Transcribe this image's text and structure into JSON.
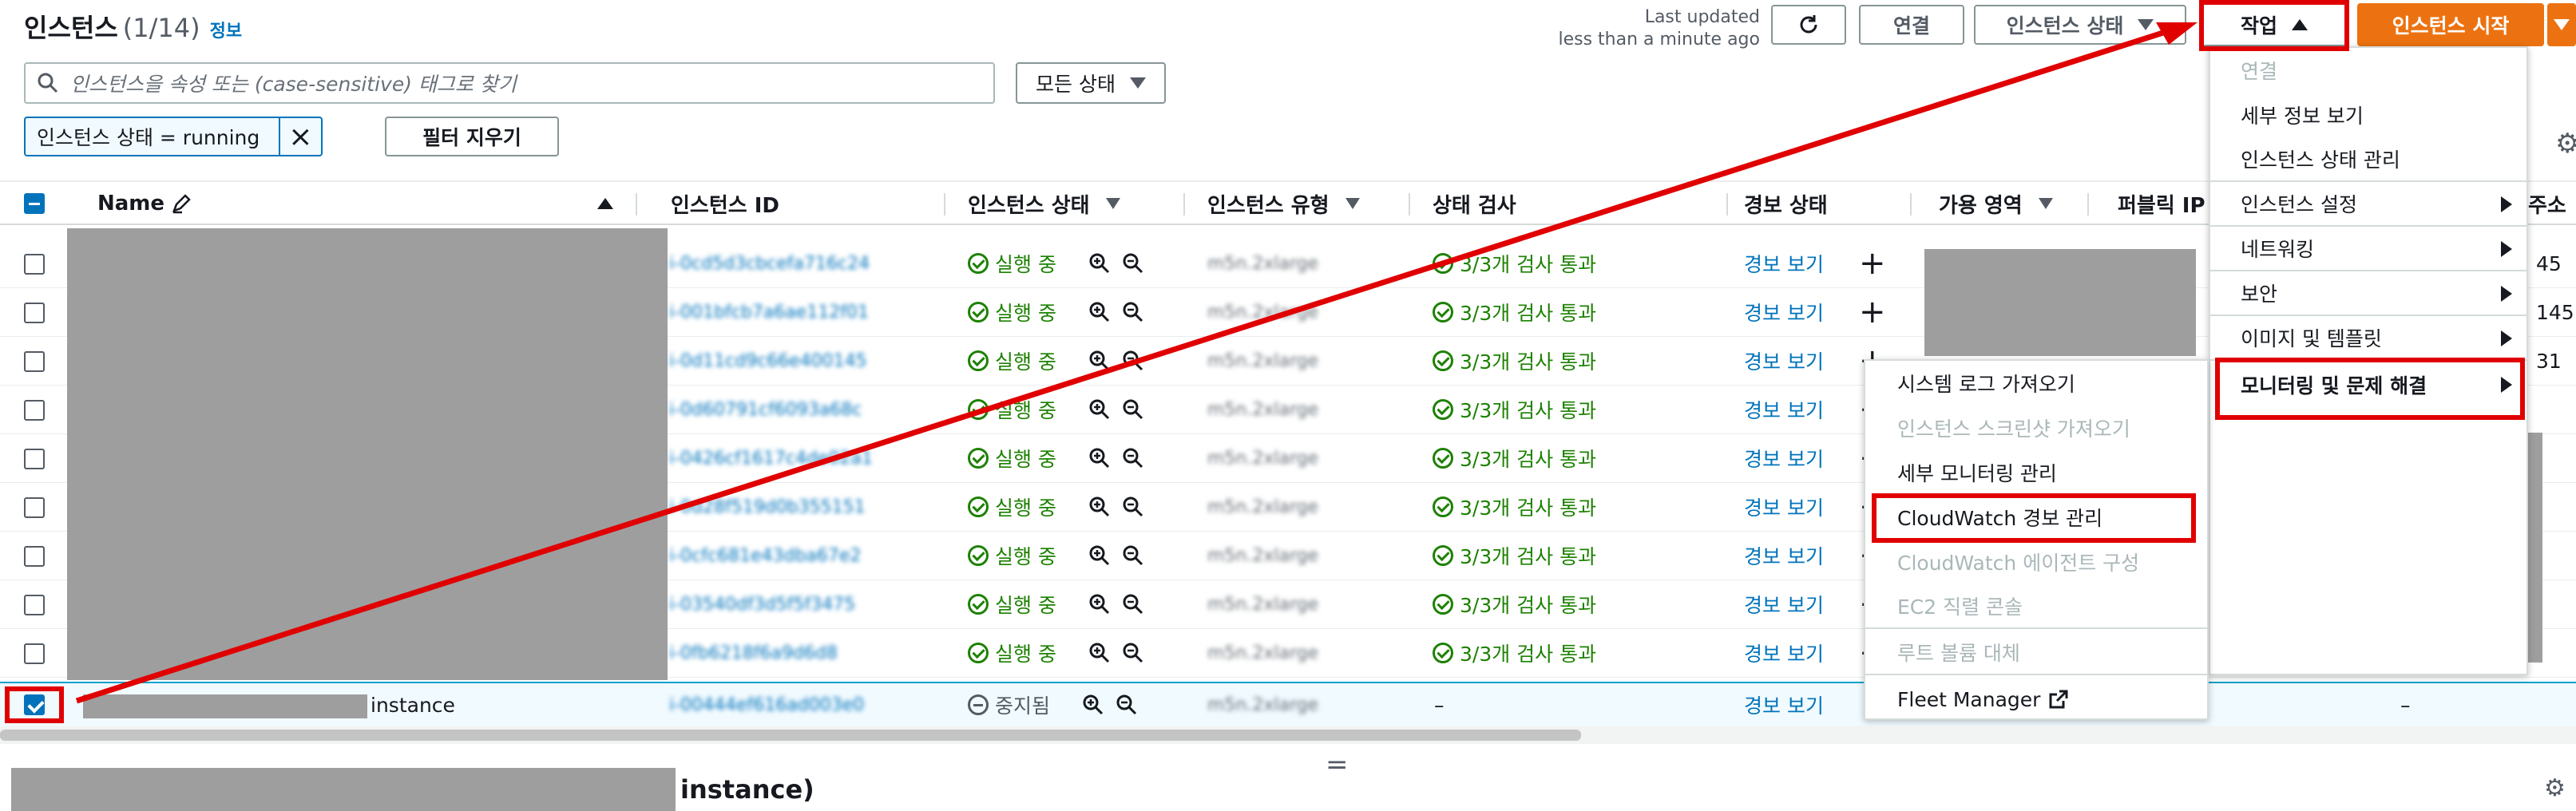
{
  "header": {
    "title": "인스턴스",
    "count": "(1/14)",
    "info": "정보",
    "last_updated_line1": "Last updated",
    "last_updated_line2": "less than a minute ago",
    "connect_label": "연결",
    "instance_state_label": "인스턴스 상태",
    "actions_label": "작업",
    "launch_label": "인스턴스 시작"
  },
  "search": {
    "placeholder": "인스턴스을 속성 또는 (case-sensitive) 태그로 찾기",
    "status_filter": "모든 상태"
  },
  "filter": {
    "chip": "인스턴스 상태 = running",
    "clear_label": "필터 지우기"
  },
  "table": {
    "columns": {
      "name": "Name",
      "instance_id": "인스턴스 ID",
      "state": "인스턴스 상태",
      "type": "인스턴스 유형",
      "status_check": "상태 검사",
      "alarm": "경보 상태",
      "az": "가용 영역",
      "public_ip": "퍼블릭 IP",
      "address": "주소"
    },
    "rows": [
      {
        "id": "i-0cd5d3cbcefa716c24",
        "state": "실행 중",
        "type": "m5n.2xlarge",
        "check": "3/3개 검사 통과",
        "alarm": "경보 보기",
        "ip_tail": "45"
      },
      {
        "id": "i-001bfcb7a6ae112f01",
        "state": "실행 중",
        "type": "m5n.2xlarge",
        "check": "3/3개 검사 통과",
        "alarm": "경보 보기",
        "ip_tail": "145"
      },
      {
        "id": "i-0d11cd9c66e400145",
        "state": "실행 중",
        "type": "m5n.2xlarge",
        "check": "3/3개 검사 통과",
        "alarm": "경보 보기",
        "ip_tail": "31"
      },
      {
        "id": "i-0d60791cf6093a68c",
        "state": "실행 중",
        "type": "m5n.2xlarge",
        "check": "3/3개 검사 통과",
        "alarm": "경보 보기",
        "ip_tail": ""
      },
      {
        "id": "i-0426cf1617c4de02a1",
        "state": "실행 중",
        "type": "m5n.2xlarge",
        "check": "3/3개 검사 통과",
        "alarm": "경보 보기",
        "ip_tail": ""
      },
      {
        "id": "i-0d28f519d0b355151",
        "state": "실행 중",
        "type": "m5n.2xlarge",
        "check": "3/3개 검사 통과",
        "alarm": "경보 보기",
        "ip_tail": ""
      },
      {
        "id": "i-0cfc681e43dba67e2",
        "state": "실행 중",
        "type": "m5n.2xlarge",
        "check": "3/3개 검사 통과",
        "alarm": "경보 보기",
        "ip_tail": ""
      },
      {
        "id": "i-03540df3d5f5f3475",
        "state": "실행 중",
        "type": "m5n.2xlarge",
        "check": "3/3개 검사 통과",
        "alarm": "경보 보기",
        "ip_tail": ""
      },
      {
        "id": "i-0fb6218f6a9d6d8",
        "state": "실행 중",
        "type": "m5n.2xlarge",
        "check": "3/3개 검사 통과",
        "alarm": "경보 보기",
        "ip_tail": ""
      }
    ],
    "selected_row": {
      "name_suffix": "instance",
      "id": "i-00444ef616ad003e0",
      "state": "중지됨",
      "type": "m5n.2xlarge",
      "check": "–",
      "alarm": "경보 보기",
      "ip": "–"
    }
  },
  "actions_menu": {
    "items": [
      {
        "label": "연결",
        "disabled": true
      },
      {
        "label": "세부 정보 보기"
      },
      {
        "label": "인스턴스 상태 관리"
      },
      {
        "label": "인스턴스 설정"
      },
      {
        "label": "네트워킹"
      },
      {
        "label": "보안"
      },
      {
        "label": "이미지 및 템플릿"
      },
      {
        "label": "모니터링 및 문제 해결"
      }
    ]
  },
  "monitoring_menu": {
    "items": [
      {
        "label": "시스템 로그 가져오기"
      },
      {
        "label": "인스턴스 스크린샷 가져오기",
        "disabled": true
      },
      {
        "label": "세부 모니터링 관리"
      },
      {
        "label": "CloudWatch 경보 관리"
      },
      {
        "label": "CloudWatch 에이전트 구성",
        "disabled": true
      },
      {
        "label": "EC2 직렬 콘솔",
        "disabled": true
      },
      {
        "label": "루트 볼륨 대체",
        "disabled": true
      },
      {
        "label": "Fleet Manager"
      }
    ]
  },
  "bottom": {
    "title_suffix": "instance)"
  },
  "colors": {
    "accent": "#ec7211",
    "link": "#0073bb",
    "success": "#1d8102",
    "highlight": "#e00000"
  }
}
